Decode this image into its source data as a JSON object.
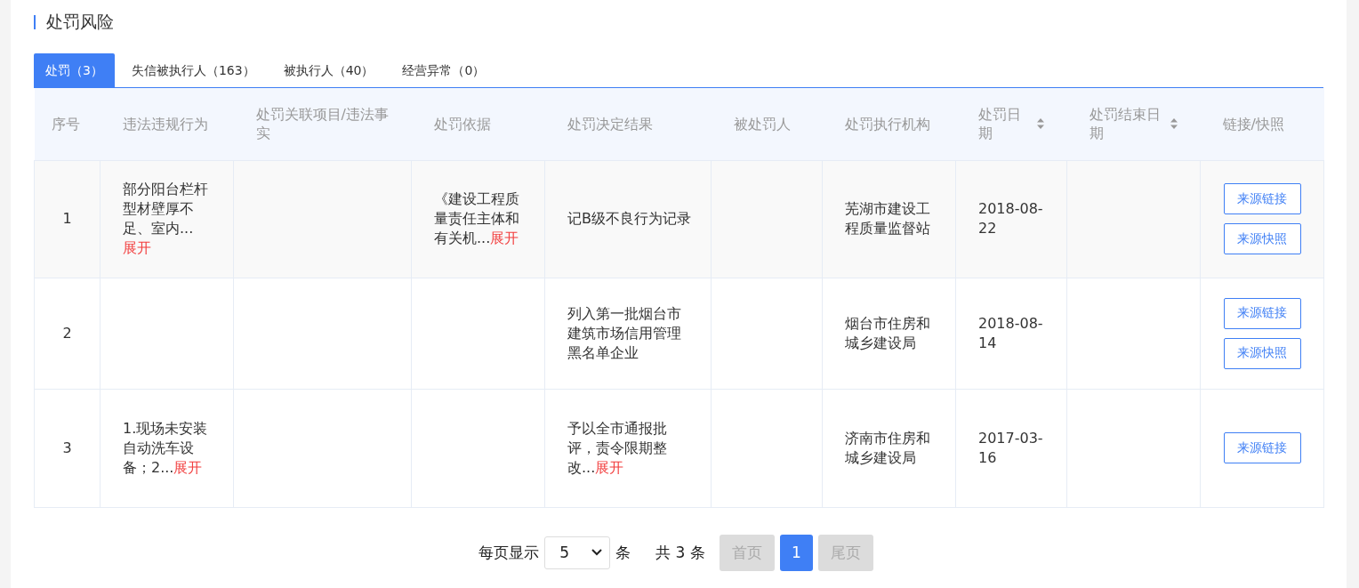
{
  "section": {
    "title": "处罚风险"
  },
  "tabs": [
    {
      "label": "处罚（3）",
      "selected": true
    },
    {
      "label": "失信被执行人（163）",
      "selected": false
    },
    {
      "label": "被执行人（40）",
      "selected": false
    },
    {
      "label": "经营异常（0）",
      "selected": false
    }
  ],
  "table": {
    "columns": [
      {
        "label": "序号",
        "sortable": false
      },
      {
        "label": "违法违规行为",
        "sortable": false
      },
      {
        "label": "处罚关联项目/违法事实",
        "sortable": false
      },
      {
        "label": "处罚依据",
        "sortable": false
      },
      {
        "label": "处罚决定结果",
        "sortable": false
      },
      {
        "label": "被处罚人",
        "sortable": false
      },
      {
        "label": "处罚执行机构",
        "sortable": false
      },
      {
        "label": "处罚日期",
        "sortable": true
      },
      {
        "label": "处罚结束日期",
        "sortable": true
      },
      {
        "label": "链接/快照",
        "sortable": false
      }
    ],
    "rows": [
      {
        "cells": [
          {
            "text": "1"
          },
          {
            "text": "部分阳台栏杆型材壁厚不足、室内...",
            "expand": "展开"
          },
          {},
          {
            "text": "《建设工程质量责任主体和有关机...",
            "expand": "展开"
          },
          {
            "text": "记B级不良行为记录"
          },
          {},
          {
            "text": "芜湖市建设工程质量监督站"
          },
          {
            "text": "2018-08-22"
          },
          {}
        ],
        "buttons": [
          "来源链接",
          "来源快照"
        ]
      },
      {
        "cells": [
          {
            "text": "2"
          },
          {},
          {},
          {},
          {
            "text": "列入第一批烟台市建筑市场信用管理黑名单企业"
          },
          {},
          {
            "text": "烟台市住房和城乡建设局"
          },
          {
            "text": "2018-08-14"
          },
          {}
        ],
        "buttons": [
          "来源链接",
          "来源快照"
        ]
      },
      {
        "cells": [
          {
            "text": "3"
          },
          {
            "text": "1.现场未安装自动洗车设备；2...",
            "expand": "展开"
          },
          {},
          {},
          {
            "text": "予以全市通报批评，责令限期整改...",
            "expand": "展开"
          },
          {},
          {
            "text": "济南市住房和城乡建设局"
          },
          {
            "text": "2017-03-16"
          },
          {}
        ],
        "buttons": [
          "来源链接"
        ]
      }
    ]
  },
  "pagination": {
    "per_page_label": "每页显示",
    "per_page": "5",
    "unit": "条",
    "total": "共 3 条",
    "pages": [
      {
        "label": "首页",
        "kind": "nav",
        "selected": false
      },
      {
        "label": "1",
        "kind": "page",
        "selected": true
      },
      {
        "label": "尾页",
        "kind": "nav",
        "selected": false
      }
    ]
  }
}
